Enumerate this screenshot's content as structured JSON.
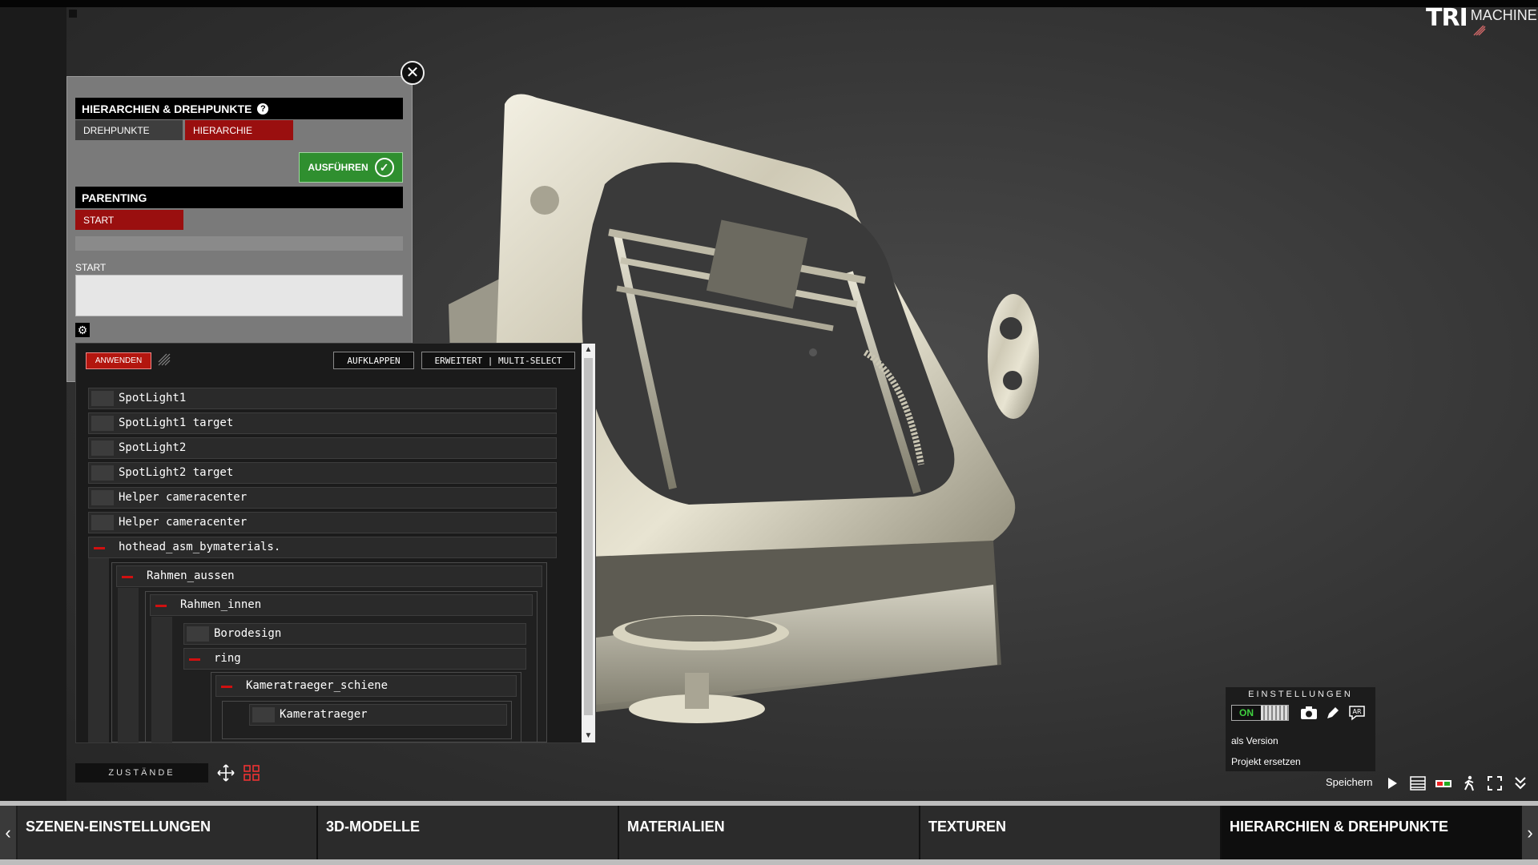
{
  "logo": {
    "part1": "TRI",
    "part2": "MACHINE"
  },
  "panel": {
    "title": "HIERARCHIEN & DREHPUNKTE",
    "help": "?",
    "tabs": [
      "DREHPUNKTE",
      "HIERARCHIE"
    ],
    "active_tab": "HIERARCHIE",
    "execute_label": "AUSFÜHREN",
    "parenting_title": "PARENTING",
    "start_tab": "START",
    "start_label": "START",
    "close_icon": "close-icon"
  },
  "tree": {
    "apply_label": "ANWENDEN",
    "expand_label": "AUFKLAPPEN",
    "advanced_label": "ERWEITERT | MULTI-SELECT",
    "items": [
      {
        "label": "SpotLight1",
        "expanded": false
      },
      {
        "label": "SpotLight1 target",
        "expanded": false
      },
      {
        "label": "SpotLight2",
        "expanded": false
      },
      {
        "label": "SpotLight2 target",
        "expanded": false
      },
      {
        "label": "Helper cameracenter",
        "expanded": false
      },
      {
        "label": "Helper cameracenter",
        "expanded": false
      },
      {
        "label": "hothead_asm_bymaterials.",
        "expanded": true
      },
      {
        "label": "Rahmen_aussen",
        "expanded": true
      },
      {
        "label": "Rahmen_innen",
        "expanded": true
      },
      {
        "label": "Borodesign",
        "expanded": false
      },
      {
        "label": "ring",
        "expanded": true
      },
      {
        "label": "Kameratraeger_schiene",
        "expanded": true
      },
      {
        "label": "Kameratraeger",
        "expanded": false
      }
    ]
  },
  "states": {
    "label": "ZUSTÄNDE"
  },
  "settings": {
    "title": "EINSTELLUNGEN",
    "toggle_label": "ON",
    "ar_label": "AR",
    "as_version": "als Version",
    "replace_project": "Projekt ersetzen",
    "save_label": "Speichern"
  },
  "bottom_nav": {
    "tabs": [
      "SZENEN-EINSTELLUNGEN",
      "3D-MODELLE",
      "MATERIALIEN",
      "TEXTUREN",
      "HIERARCHIEN & DREHPUNKTE"
    ],
    "active": "HIERARCHIEN & DREHPUNKTE"
  },
  "colors": {
    "accent_red": "#9a0f0f",
    "button_red": "#b3160f",
    "execute_green": "#2f8f2f"
  }
}
